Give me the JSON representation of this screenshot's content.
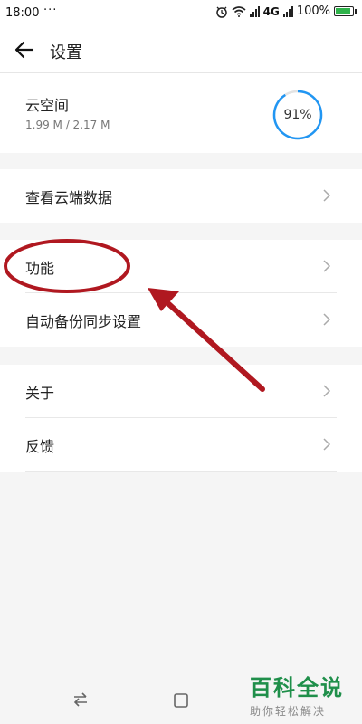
{
  "status_bar": {
    "time": "18:00",
    "dots": "···",
    "network": "4G",
    "battery_percent": "100%",
    "icons": [
      "alarm-icon",
      "wifi-icon",
      "signal-icon",
      "battery-icon"
    ]
  },
  "app_bar": {
    "title": "设置",
    "back_icon": "arrow-left-icon"
  },
  "cloud": {
    "name": "云空间",
    "usage": "1.99 M / 2.17 M",
    "percent_label": "91%",
    "percent_value": 0.91,
    "ring_color": "#2196F3"
  },
  "menu_groups": [
    {
      "items": [
        {
          "label": "查看云端数据"
        }
      ]
    },
    {
      "items": [
        {
          "label": "功能"
        },
        {
          "label": "自动备份同步设置"
        }
      ]
    },
    {
      "items": [
        {
          "label": "关于"
        },
        {
          "label": "反馈"
        }
      ]
    }
  ],
  "nav_bar": {
    "icons": [
      "swap-arrows-icon",
      "home-square-icon"
    ]
  },
  "watermark": {
    "title": "百科全说",
    "subtitle": "助你轻松解决"
  },
  "annotation_color": "#b01820"
}
